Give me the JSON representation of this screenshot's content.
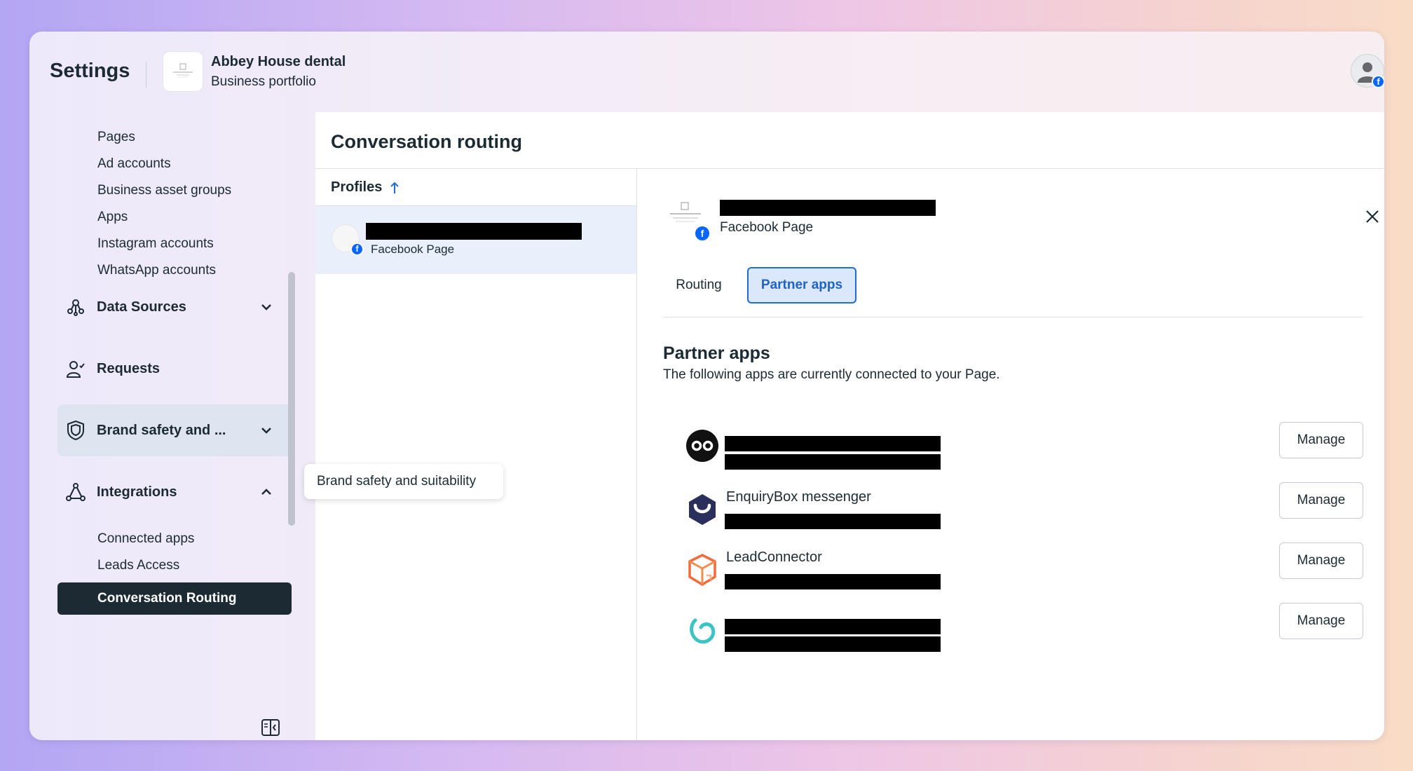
{
  "header": {
    "title": "Settings",
    "portfolio_name": "Abbey House dental",
    "portfolio_type": "Business portfolio"
  },
  "sidebar": {
    "sub_items": [
      "Pages",
      "Ad accounts",
      "Business asset groups",
      "Apps",
      "Instagram accounts",
      "WhatsApp accounts"
    ],
    "sections": {
      "data_sources": "Data Sources",
      "requests": "Requests",
      "brand_safety": "Brand safety and ...",
      "integrations": "Integrations"
    },
    "integration_items": [
      "Connected apps",
      "Leads Access"
    ],
    "active_item": "Conversation Routing",
    "tooltip": "Brand safety and suitability"
  },
  "main": {
    "title": "Conversation routing",
    "profiles_header": "Profiles",
    "profile": {
      "type": "Facebook Page"
    },
    "detail": {
      "profile_type": "Facebook Page",
      "tabs": [
        "Routing",
        "Partner apps"
      ],
      "active_tab": "Partner apps",
      "section_title": "Partner apps",
      "section_desc": "The following apps are currently connected to your Page.",
      "apps": [
        {
          "name": "",
          "button": "Manage"
        },
        {
          "name": "EnquiryBox messenger",
          "button": "Manage"
        },
        {
          "name": "LeadConnector",
          "button": "Manage"
        },
        {
          "name": "",
          "button": "Manage"
        }
      ]
    }
  },
  "colors": {
    "accent": "#0866ff",
    "active_nav_bg": "#1c2b33",
    "tab_active_border": "#1f6ed4"
  }
}
